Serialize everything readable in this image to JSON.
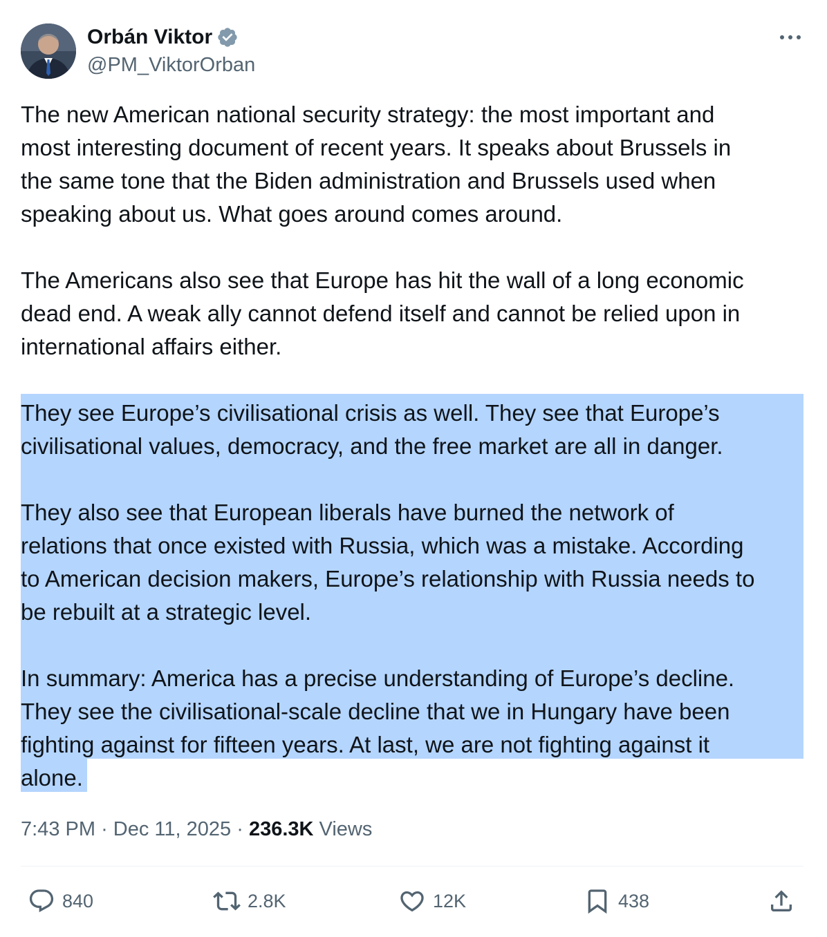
{
  "author": {
    "name": "Orbán Viktor",
    "handle": "@PM_ViktorOrban",
    "verified": true,
    "verified_color": "#829aab"
  },
  "tweet": {
    "paragraphs": [
      "The new American national security strategy: the most important and\nmost interesting document of recent years. It speaks about Brussels in\nthe same tone that the Biden administration and Brussels used when\nspeaking about us. What goes around comes around.",
      "The Americans also see that Europe has hit the wall of a long economic\ndead end. A weak ally cannot defend itself and cannot be relied upon in\ninternational affairs either.",
      "They see Europe’s civilisational crisis as well. They see that Europe’s\ncivilisational values, democracy, and the free market are all in danger.",
      "They also see that European liberals have burned the network of\nrelations that once existed with Russia, which was a mistake. According\nto American decision makers, Europe’s relationship with Russia needs to\nbe rebuilt at a strategic level.",
      "In summary: America has a precise understanding of Europe’s decline.\nThey see the civilisational-scale decline that we in Hungary have been\nfighting against for fifteen years. At last, we are not fighting against it\nalone."
    ],
    "selection_color": "#b4d5fe"
  },
  "meta": {
    "time": "7:43 PM",
    "separator": "·",
    "date": "Dec 11, 2025",
    "views_count": "236.3K",
    "views_label": "Views"
  },
  "actions": {
    "replies": "840",
    "reposts": "2.8K",
    "likes": "12K",
    "bookmarks": "438"
  },
  "icons": {
    "more": "more-dots-icon",
    "reply": "reply-bubble-icon",
    "repost": "repost-arrows-icon",
    "like": "heart-icon",
    "bookmark": "bookmark-icon",
    "share": "share-upload-icon",
    "verified": "verified-badge-icon"
  },
  "colors": {
    "text": "#0f1419",
    "secondary": "#536471",
    "divider": "#eff3f4"
  }
}
